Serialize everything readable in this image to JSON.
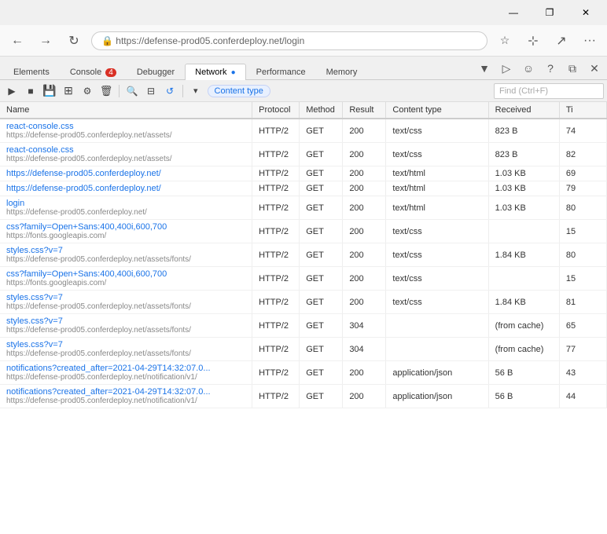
{
  "titlebar": {
    "minimize": "—",
    "restore": "❐",
    "close": "✕"
  },
  "browser": {
    "back": "←",
    "forward": "→",
    "refresh": "↻",
    "star": "☆",
    "bookmark": "⊹",
    "share": "↗",
    "more": "···"
  },
  "devtools": {
    "tabs": [
      {
        "id": "elements",
        "label": "Elements",
        "badge": null,
        "active": false
      },
      {
        "id": "console",
        "label": "Console",
        "badge": "4",
        "badgeType": "error",
        "active": false
      },
      {
        "id": "debugger",
        "label": "Debugger",
        "badge": null,
        "active": false
      },
      {
        "id": "network",
        "label": "Network",
        "badge": null,
        "active": true
      },
      {
        "id": "performance",
        "label": "Performance",
        "badge": null,
        "active": false
      },
      {
        "id": "memory",
        "label": "Memory",
        "badge": null,
        "active": false
      }
    ],
    "rightIcons": [
      "▼",
      "▷",
      "☺",
      "?",
      "⧉",
      "✕"
    ]
  },
  "network_toolbar": {
    "buttons": [
      {
        "id": "play",
        "icon": "▶",
        "active": false
      },
      {
        "id": "stop",
        "icon": "■",
        "active": false
      },
      {
        "id": "save",
        "icon": "💾",
        "active": false
      },
      {
        "id": "import",
        "icon": "⊞",
        "active": false
      },
      {
        "id": "settings",
        "icon": "⚙",
        "active": false
      },
      {
        "id": "clear",
        "icon": "🗑",
        "active": false
      },
      {
        "id": "search",
        "icon": "🔍",
        "active": false
      },
      {
        "id": "breakpoints",
        "icon": "⊟",
        "active": false
      },
      {
        "id": "reload",
        "icon": "↺",
        "active": false
      }
    ],
    "filter_icon": "▾",
    "filter_label": "Content type",
    "search_placeholder": "Find (Ctrl+F)"
  },
  "table": {
    "headers": [
      "Name",
      "Protocol",
      "Method",
      "Result",
      "Content type",
      "Received",
      "Ti"
    ],
    "rows": [
      {
        "name": "react-console.css",
        "url": "https://defense-prod05.conferdeploy.net/assets/",
        "protocol": "HTTP/2",
        "method": "GET",
        "result": "200",
        "content_type": "text/css",
        "received": "823 B",
        "time": "74"
      },
      {
        "name": "react-console.css",
        "url": "https://defense-prod05.conferdeploy.net/assets/",
        "protocol": "HTTP/2",
        "method": "GET",
        "result": "200",
        "content_type": "text/css",
        "received": "823 B",
        "time": "82"
      },
      {
        "name": "https://defense-prod05.conferdeploy.net/",
        "url": "",
        "protocol": "HTTP/2",
        "method": "GET",
        "result": "200",
        "content_type": "text/html",
        "received": "1.03 KB",
        "time": "69"
      },
      {
        "name": "https://defense-prod05.conferdeploy.net/",
        "url": "",
        "protocol": "HTTP/2",
        "method": "GET",
        "result": "200",
        "content_type": "text/html",
        "received": "1.03 KB",
        "time": "79"
      },
      {
        "name": "login",
        "url": "https://defense-prod05.conferdeploy.net/",
        "protocol": "HTTP/2",
        "method": "GET",
        "result": "200",
        "content_type": "text/html",
        "received": "1.03 KB",
        "time": "80"
      },
      {
        "name": "css?family=Open+Sans:400,400i,600,700",
        "url": "https://fonts.googleapis.com/",
        "protocol": "HTTP/2",
        "method": "GET",
        "result": "200",
        "content_type": "text/css",
        "received": "",
        "time": "15"
      },
      {
        "name": "styles.css?v=7",
        "url": "https://defense-prod05.conferdeploy.net/assets/fonts/",
        "protocol": "HTTP/2",
        "method": "GET",
        "result": "200",
        "content_type": "text/css",
        "received": "1.84 KB",
        "time": "80"
      },
      {
        "name": "css?family=Open+Sans:400,400i,600,700",
        "url": "https://fonts.googleapis.com/",
        "protocol": "HTTP/2",
        "method": "GET",
        "result": "200",
        "content_type": "text/css",
        "received": "",
        "time": "15"
      },
      {
        "name": "styles.css?v=7",
        "url": "https://defense-prod05.conferdeploy.net/assets/fonts/",
        "protocol": "HTTP/2",
        "method": "GET",
        "result": "200",
        "content_type": "text/css",
        "received": "1.84 KB",
        "time": "81"
      },
      {
        "name": "styles.css?v=7",
        "url": "https://defense-prod05.conferdeploy.net/assets/fonts/",
        "protocol": "HTTP/2",
        "method": "GET",
        "result": "304",
        "content_type": "",
        "received": "(from cache)",
        "time": "65"
      },
      {
        "name": "styles.css?v=7",
        "url": "https://defense-prod05.conferdeploy.net/assets/fonts/",
        "protocol": "HTTP/2",
        "method": "GET",
        "result": "304",
        "content_type": "",
        "received": "(from cache)",
        "time": "77"
      },
      {
        "name": "notifications?created_after=2021-04-29T14:32:07.0...",
        "url": "https://defense-prod05.conferdeploy.net/notification/v1/",
        "protocol": "HTTP/2",
        "method": "GET",
        "result": "200",
        "content_type": "application/json",
        "received": "56 B",
        "time": "43"
      },
      {
        "name": "notifications?created_after=2021-04-29T14:32:07.0...",
        "url": "https://defense-prod05.conferdeploy.net/notification/v1/",
        "protocol": "HTTP/2",
        "method": "GET",
        "result": "200",
        "content_type": "application/json",
        "received": "56 B",
        "time": "44"
      }
    ]
  }
}
